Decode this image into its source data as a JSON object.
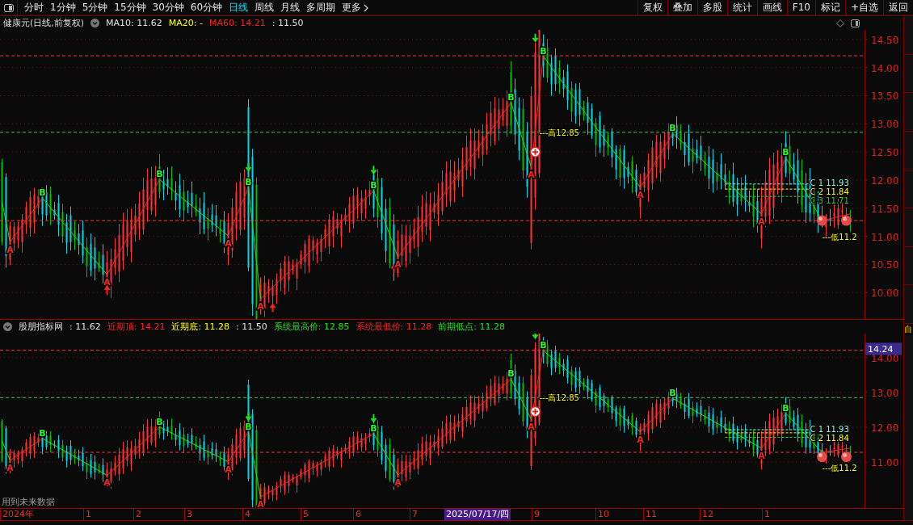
{
  "toolbar": {
    "periods": [
      {
        "label": "分时",
        "selected": false
      },
      {
        "label": "1分钟",
        "selected": false
      },
      {
        "label": "5分钟",
        "selected": false
      },
      {
        "label": "15分钟",
        "selected": false
      },
      {
        "label": "30分钟",
        "selected": false
      },
      {
        "label": "60分钟",
        "selected": false
      },
      {
        "label": "日线",
        "selected": true
      },
      {
        "label": "周线",
        "selected": false
      },
      {
        "label": "月线",
        "selected": false
      },
      {
        "label": "多周期",
        "selected": false
      },
      {
        "label": "更多",
        "selected": false
      }
    ],
    "buttons": [
      "复权",
      "叠加",
      "多股",
      "统计",
      "画线",
      "F10",
      "标记",
      "+自选",
      "返回"
    ]
  },
  "main_legend": {
    "title": "健康元(日线,前复权)",
    "items": [
      {
        "text": "MA10: 11.62",
        "color": "#e0e0e0"
      },
      {
        "text": "MA20: -",
        "color": "#ffff00"
      },
      {
        "text": "MA60: 14.21",
        "color": "#ff2020"
      },
      {
        "text": ": 11.50",
        "color": "#e0e0e0"
      }
    ]
  },
  "main_chart": {
    "price_labels": [
      "14.50",
      "14.00",
      "13.50",
      "13.00",
      "12.50",
      "12.00",
      "11.50",
      "11.00",
      "10.50",
      "10.00"
    ],
    "markers": [
      {
        "kind": "low",
        "text": "A"
      },
      {
        "kind": "high",
        "text": "B"
      },
      {
        "kind": "low",
        "text": "A"
      },
      {
        "kind": "high",
        "text": "B"
      },
      {
        "kind": "low",
        "text": "A"
      },
      {
        "kind": "high",
        "text": "B"
      },
      {
        "kind": "low",
        "text": "A"
      },
      {
        "kind": "high",
        "text": "B"
      },
      {
        "kind": "low",
        "text": "A"
      },
      {
        "kind": "high",
        "text": "B"
      },
      {
        "kind": "low",
        "text": "A"
      },
      {
        "kind": "high",
        "text": "B"
      },
      {
        "kind": "low",
        "text": "A"
      },
      {
        "kind": "high",
        "text": "B"
      },
      {
        "kind": "low",
        "text": "A"
      },
      {
        "kind": "high",
        "text": "B"
      }
    ],
    "notes": [
      {
        "text": "---高12.85",
        "color": "#ffff00"
      },
      {
        "text": "C 1 11.93",
        "color": "#80ffe0"
      },
      {
        "text": "C 2 11.84",
        "color": "#ffff00"
      },
      {
        "text": "C 3 11.71",
        "color": "#30d030"
      },
      {
        "text": "---低11.2",
        "color": "#ffff00"
      }
    ]
  },
  "indicator_legend": {
    "title": "股朋指标网",
    "items": [
      {
        "text": ": 11.62",
        "color": "#e0e0e0"
      },
      {
        "text": "近期顶: 14.21",
        "color": "#ff2020"
      },
      {
        "text": "近期底: 11.28",
        "color": "#ffff00"
      },
      {
        "text": ": 11.50",
        "color": "#e0e0e0"
      },
      {
        "text": "系统最高价: 12.85",
        "color": "#20e020"
      },
      {
        "text": "系统最低价: 11.28",
        "color": "#ff2020"
      },
      {
        "text": "前期低点: 11.28",
        "color": "#20e020"
      }
    ]
  },
  "indicator_chart": {
    "price_labels": [
      "14.00",
      "13.00",
      "12.00",
      "11.00"
    ],
    "cursor_price": "14.24",
    "note": "用到未来数据",
    "markers": [
      {
        "kind": "low",
        "text": "A"
      },
      {
        "kind": "high",
        "text": "B"
      },
      {
        "kind": "low",
        "text": "A"
      },
      {
        "kind": "high",
        "text": "B"
      },
      {
        "kind": "low",
        "text": "A"
      },
      {
        "kind": "high",
        "text": "B"
      },
      {
        "kind": "low",
        "text": "A"
      },
      {
        "kind": "high",
        "text": "B"
      },
      {
        "kind": "low",
        "text": "A"
      },
      {
        "kind": "high",
        "text": "B"
      },
      {
        "kind": "low",
        "text": "A"
      },
      {
        "kind": "high",
        "text": "B"
      },
      {
        "kind": "low",
        "text": "A"
      },
      {
        "kind": "high",
        "text": "B"
      },
      {
        "kind": "low",
        "text": "A"
      },
      {
        "kind": "high",
        "text": "B"
      }
    ],
    "notes": [
      {
        "text": "---高12.85",
        "color": "#ffff00"
      },
      {
        "text": "C 1 11.93",
        "color": "#80ffe0"
      },
      {
        "text": "C 2 11.84",
        "color": "#ffff00"
      },
      {
        "text": "---低11.2",
        "color": "#ffff00"
      }
    ]
  },
  "time_axis": {
    "labels": [
      "2024年",
      "1",
      "2",
      "3",
      "4",
      "5",
      "6",
      "7",
      "9",
      "10",
      "11",
      "12",
      "1"
    ],
    "cursor": "2025/07/17/四"
  },
  "side_panel": {
    "label": "自"
  }
}
